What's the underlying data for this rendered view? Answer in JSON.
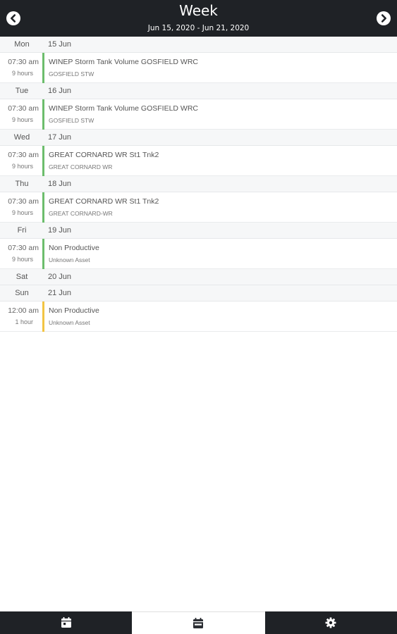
{
  "header": {
    "title": "Week",
    "range": "Jun 15, 2020 - Jun 21, 2020",
    "prev_icon": "chevron-left-circle-icon",
    "next_icon": "chevron-right-circle-icon",
    "background": "#1f2226"
  },
  "colors": {
    "green": "#6cbd6c",
    "yellow": "#f2c443"
  },
  "days": [
    {
      "dow": "Mon",
      "date": "15 Jun",
      "events": [
        {
          "time": "07:30 am",
          "duration": "9 hours",
          "title": "WINEP Storm Tank Volume GOSFIELD WRC",
          "subtitle": "GOSFIELD STW",
          "color": "#6cbd6c"
        }
      ]
    },
    {
      "dow": "Tue",
      "date": "16 Jun",
      "events": [
        {
          "time": "07:30 am",
          "duration": "9 hours",
          "title": "WINEP Storm Tank Volume GOSFIELD WRC",
          "subtitle": "GOSFIELD STW",
          "color": "#6cbd6c"
        }
      ]
    },
    {
      "dow": "Wed",
      "date": "17 Jun",
      "events": [
        {
          "time": "07:30 am",
          "duration": "9 hours",
          "title": "GREAT CORNARD WR St1 Tnk2",
          "subtitle": "GREAT CORNARD WR",
          "color": "#6cbd6c"
        }
      ]
    },
    {
      "dow": "Thu",
      "date": "18 Jun",
      "events": [
        {
          "time": "07:30 am",
          "duration": "9 hours",
          "title": "GREAT CORNARD WR St1 Tnk2",
          "subtitle": "GREAT CORNARD-WR",
          "color": "#6cbd6c"
        }
      ]
    },
    {
      "dow": "Fri",
      "date": "19 Jun",
      "events": [
        {
          "time": "07:30 am",
          "duration": "9 hours",
          "title": "Non Productive",
          "subtitle": "Unknown Asset",
          "color": "#6cbd6c"
        }
      ]
    },
    {
      "dow": "Sat",
      "date": "20 Jun",
      "events": []
    },
    {
      "dow": "Sun",
      "date": "21 Jun",
      "events": [
        {
          "time": "12:00 am",
          "duration": "1 hour",
          "title": "Non Productive",
          "subtitle": "Unknown Asset",
          "color": "#f2c443"
        }
      ]
    }
  ],
  "tabbar": {
    "tabs": [
      {
        "icon": "calendar-day-icon",
        "active": false
      },
      {
        "icon": "calendar-week-icon",
        "active": true
      },
      {
        "icon": "settings-gear-icon",
        "active": false
      }
    ]
  }
}
